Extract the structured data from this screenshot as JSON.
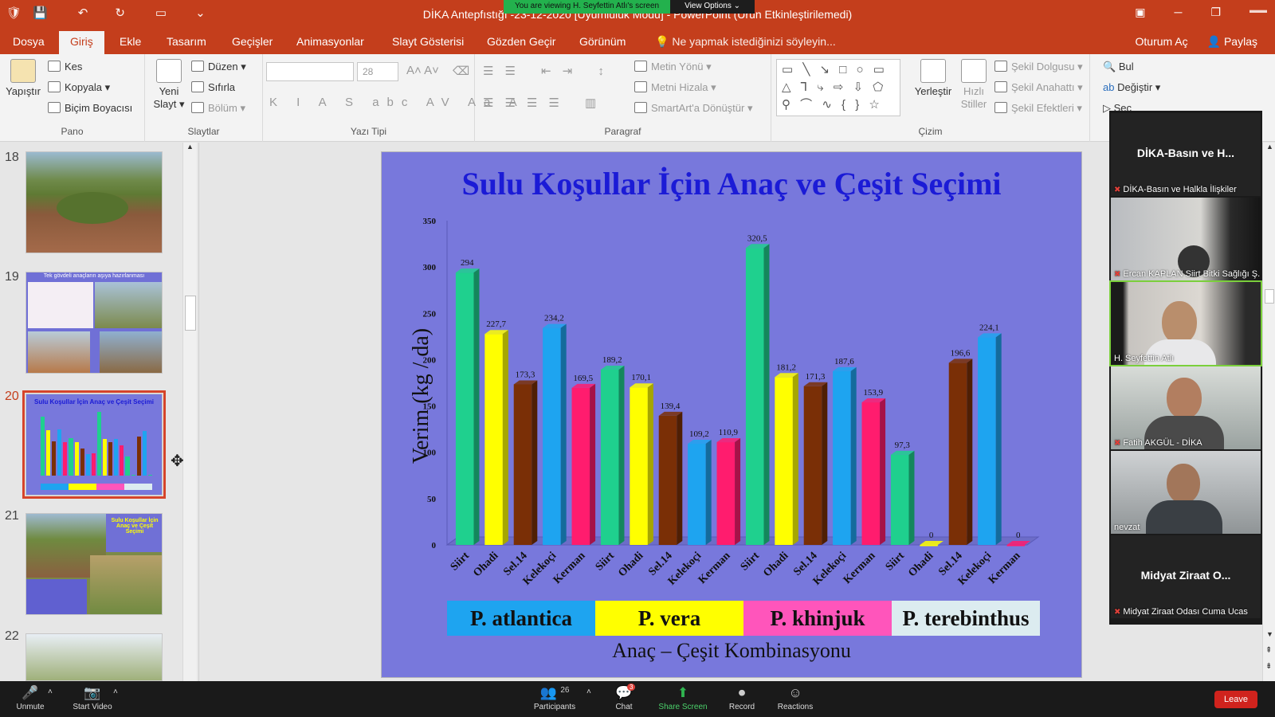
{
  "window": {
    "title": "DİKA Antepfıstığı -23-12-2020 [Uyumluluk Modu] - PowerPoint (Ürün Etkinleştirilemedi)",
    "viewing_banner": "You are viewing H. Seyfettin Atlı's screen",
    "view_options": "View Options ⌄"
  },
  "menu": {
    "tabs": [
      "Dosya",
      "Giriş",
      "Ekle",
      "Tasarım",
      "Geçişler",
      "Animasyonlar",
      "Slayt Gösterisi",
      "Gözden Geçir",
      "Görünüm"
    ],
    "active_tab": "Giriş",
    "tell_me": "Ne yapmak istediğinizi söyleyin...",
    "sign_in": "Oturum Aç",
    "share": "Paylaş"
  },
  "ribbon": {
    "pano": {
      "label": "Pano",
      "paste": "Yapıştır",
      "cut": "Kes",
      "copy": "Kopyala",
      "format_painter": "Biçim Boyacısı"
    },
    "slaytlar": {
      "label": "Slaytlar",
      "new_slide_1": "Yeni",
      "new_slide_2": "Slayt",
      "layout": "Düzen",
      "reset": "Sıfırla",
      "section": "Bölüm"
    },
    "yazi_tipi": {
      "label": "Yazı Tipi",
      "font_name": "",
      "font_size": "28"
    },
    "paragraf": {
      "label": "Paragraf",
      "text_direction": "Metin Yönü",
      "align_text": "Metni Hizala",
      "smartart": "SmartArt'a Dönüştür"
    },
    "cizim": {
      "label": "Çizim",
      "arrange": "Yerleştir",
      "quick_styles_1": "Hızlı",
      "quick_styles_2": "Stiller",
      "shape_fill": "Şekil Dolgusu",
      "shape_outline": "Şekil Anahattı",
      "shape_effects": "Şekil Efektleri"
    },
    "duzenleme": {
      "find": "Bul",
      "replace": "Değiştir",
      "select": "Seç"
    }
  },
  "thumbnails": {
    "numbers": [
      "18",
      "19",
      "20",
      "21",
      "22"
    ],
    "active": "20",
    "slide19_caption": "Tek gövdeli anaçların aşıya hazırlanması",
    "slide20_caption": "Sulu Koşullar İçin Anaç ve Çeşit Seçimi",
    "slide21_caption": "Sulu Koşullar İçin Anaç ve Çeşit Seçimi"
  },
  "slide": {
    "title": "Sulu Koşullar İçin Anaç ve Çeşit Seçimi"
  },
  "chart_data": {
    "type": "bar",
    "title": "Sulu Koşullar İçin Anaç ve Çeşit Seçimi",
    "ylabel": "Verim (kg / da)",
    "xlabel": "Anaç – Çeşit Kombinasyonu",
    "ylim": [
      0,
      350
    ],
    "yticks": [
      0,
      50,
      100,
      150,
      200,
      250,
      300,
      350
    ],
    "grid": false,
    "categories": [
      "Siirt",
      "Ohadi",
      "Sel.14",
      "Kelekoçi",
      "Kerman",
      "Siirt",
      "Ohadi",
      "Sel.14",
      "Kelekoçi",
      "Kerman",
      "Siirt",
      "Ohadi",
      "Sel.14",
      "Kelekoçi",
      "Kerman",
      "Siirt",
      "Ohadi",
      "Sel.14",
      "Kelekoçi",
      "Kerman"
    ],
    "groups": [
      "P. atlantica",
      "P. vera",
      "P. khinjuk",
      "P. terebinthus"
    ],
    "values": [
      294,
      227.7,
      173.3,
      234.2,
      169.5,
      189.2,
      170.1,
      139.4,
      109.2,
      110.9,
      320.5,
      181.2,
      171.3,
      187.6,
      153.9,
      97.3,
      0,
      196.6,
      224.1,
      0
    ],
    "value_labels": [
      "294",
      "227,7",
      "173,3",
      "234,2",
      "169,5",
      "189,2",
      "170,1",
      "139,4",
      "109,2",
      "110,9",
      "320,5",
      "181,2",
      "171,3",
      "187,6",
      "153,9",
      "97,3",
      "0",
      "196,6",
      "224,1",
      "0"
    ],
    "bar_colors": [
      "#1fd08e",
      "#ffff00",
      "#7a2f06",
      "#1ea4f0",
      "#ff1c6e"
    ],
    "group_colors": [
      "#1ea4f0",
      "#ffff00",
      "#ff55bb",
      "#dcecf0"
    ],
    "background": "#7878dc"
  },
  "participants": {
    "tiles": [
      {
        "big": "DİKA-Basın ve H...",
        "name": "DİKA-Basın ve Halkla İlişkiler"
      },
      {
        "big": "",
        "name": "Ercan KAPLAN Siirt Bitki Sağlığı Ş..."
      },
      {
        "big": "",
        "name": "H. Seyfettin Atlı"
      },
      {
        "big": "",
        "name": "Fatih AKGÜL - DİKA"
      },
      {
        "big": "",
        "name": "nevzat"
      },
      {
        "big": "Midyat Ziraat O...",
        "name": "Midyat Ziraat Odası Cuma Ucas"
      }
    ]
  },
  "zoom_toolbar": {
    "unmute": "Unmute",
    "start_video": "Start Video",
    "participants": "Participants",
    "participants_count": "26",
    "chat": "Chat",
    "chat_badge": "3",
    "share_screen": "Share Screen",
    "record": "Record",
    "reactions": "Reactions",
    "leave": "Leave"
  }
}
